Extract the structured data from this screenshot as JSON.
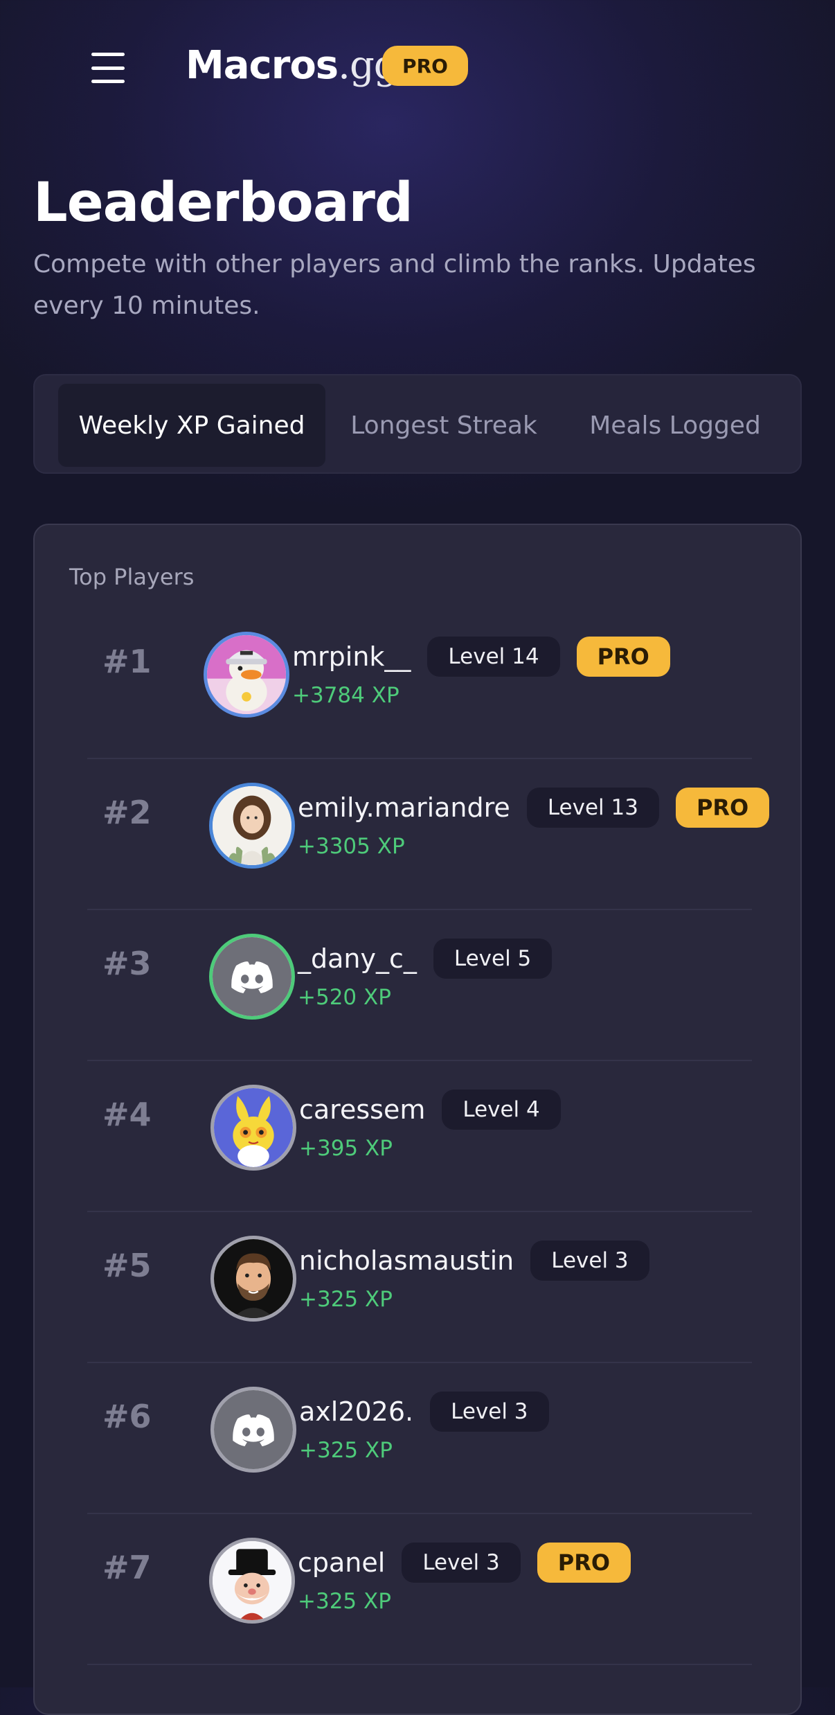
{
  "header": {
    "logo_main": "Macros",
    "logo_suffix": ".gg",
    "pro_label": "PRO"
  },
  "page": {
    "title": "Leaderboard",
    "subtitle": "Compete with other players and climb the ranks. Updates every 10 minutes."
  },
  "tabs": [
    {
      "label": "Weekly XP Gained",
      "active": true
    },
    {
      "label": "Longest Streak",
      "active": false
    },
    {
      "label": "Meals Logged",
      "active": false
    }
  ],
  "card": {
    "title": "Top Players"
  },
  "players": [
    {
      "rank": "#1",
      "name": "mrpink__",
      "level": "Level 14",
      "pro": "PRO",
      "xp": "+3784 XP",
      "avatar": "duck-avatar-icon",
      "ring": "#5b8be0"
    },
    {
      "rank": "#2",
      "name": "emily.mariandre",
      "level": "Level 13",
      "pro": "PRO",
      "xp": "+3305 XP",
      "avatar": "woman-avatar-icon",
      "ring": "#4a86d8"
    },
    {
      "rank": "#3",
      "name": "_dany_c_",
      "level": "Level 5",
      "pro": "",
      "xp": "+520 XP",
      "avatar": "discord-icon",
      "ring": "#4ecb7a"
    },
    {
      "rank": "#4",
      "name": "caressem",
      "level": "Level 4",
      "pro": "",
      "xp": "+395 XP",
      "avatar": "bunny-avatar-icon",
      "ring": "#a0a0ac"
    },
    {
      "rank": "#5",
      "name": "nicholasmaustin",
      "level": "Level 3",
      "pro": "",
      "xp": "+325 XP",
      "avatar": "man-avatar-icon",
      "ring": "#a0a0ac"
    },
    {
      "rank": "#6",
      "name": "axl2026.",
      "level": "Level 3",
      "pro": "",
      "xp": "+325 XP",
      "avatar": "discord-icon",
      "ring": "#a0a0ac"
    },
    {
      "rank": "#7",
      "name": "cpanel",
      "level": "Level 3",
      "pro": "PRO",
      "xp": "+325 XP",
      "avatar": "monopoly-avatar-icon",
      "ring": "#a0a0ac"
    }
  ],
  "colors": {
    "accent_pro": "#f6b93b",
    "xp_green": "#4ecb7a"
  }
}
